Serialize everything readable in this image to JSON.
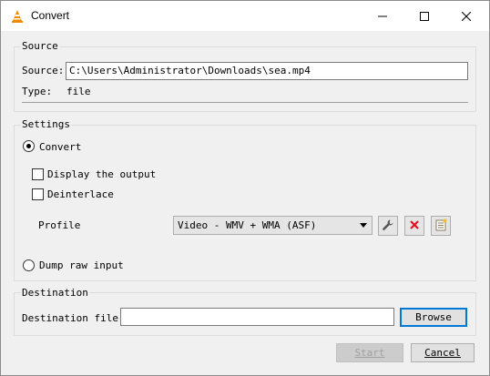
{
  "window": {
    "title": "Convert",
    "app_icon": "vlc-cone-icon",
    "controls": [
      "minimize-icon",
      "maximize-icon",
      "close-icon"
    ]
  },
  "source": {
    "group_title": "Source",
    "source_label": "Source:",
    "source_value": "C:\\Users\\Administrator\\Downloads\\sea.mp4",
    "type_label": "Type:",
    "type_value": "file"
  },
  "settings": {
    "group_title": "Settings",
    "convert_label": "Convert",
    "convert_selected": true,
    "display_output_label": "Display the output",
    "display_output_checked": false,
    "deinterlace_label": "Deinterlace",
    "deinterlace_checked": false,
    "profile_label": "Profile",
    "profile_value": "Video - WMV + WMA (ASF)",
    "profile_tools": [
      "wrench-icon",
      "delete-icon",
      "new-profile-icon"
    ],
    "dump_raw_label": "Dump raw input",
    "dump_raw_selected": false
  },
  "destination": {
    "group_title": "Destination",
    "file_label": "Destination file:",
    "file_value": "",
    "browse_label": "Browse"
  },
  "buttons": {
    "start_label": "Start",
    "start_enabled": false,
    "cancel_label": "Cancel"
  },
  "colors": {
    "focus_border": "#0078d7",
    "delete_red": "#e81123",
    "vlc_orange": "#f08a00"
  }
}
